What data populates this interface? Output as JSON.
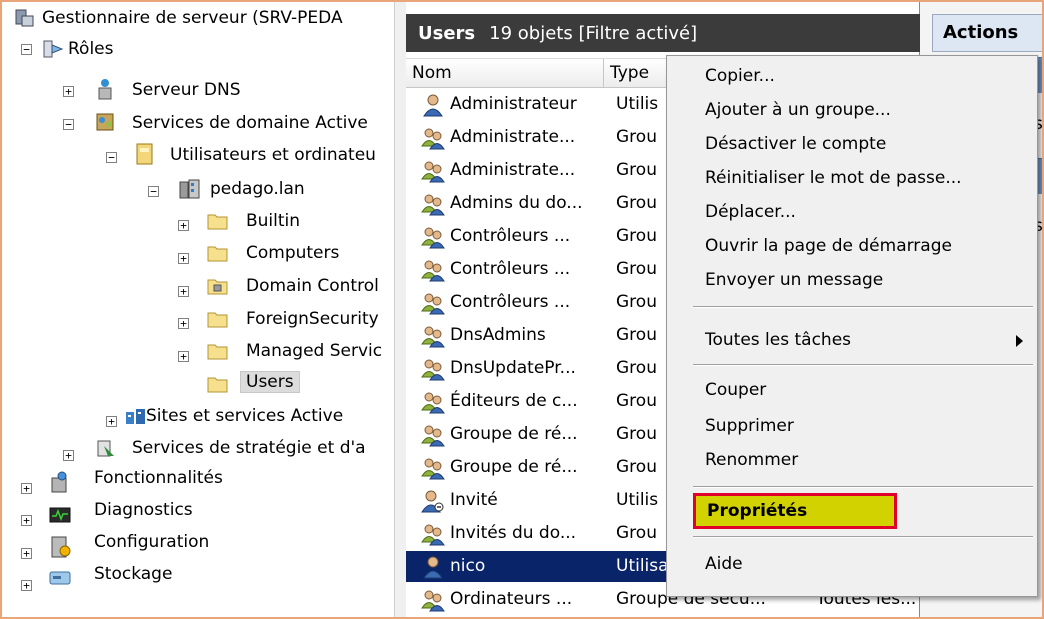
{
  "tree": {
    "root": "Gestionnaire de serveur (SRV-PEDA",
    "roles": "Rôles",
    "dns": "Serveur DNS",
    "adds": "Services de domaine Active",
    "aduc": "Utilisateurs et ordinateu",
    "domain": "pedago.lan",
    "builtin": "Builtin",
    "computers": "Computers",
    "dc": "Domain Control",
    "fsp": "ForeignSecurity",
    "msa": "Managed Servic",
    "users": "Users",
    "sites": "Sites et services Active",
    "gpm": "Services de stratégie et d'a",
    "features": "Fonctionnalités",
    "diagnostics": "Diagnostics",
    "configuration": "Configuration",
    "storage": "Stockage"
  },
  "middle": {
    "title": "Users",
    "subtitle": "19 objets  [Filtre activé]",
    "col_name": "Nom",
    "col_type": "Type",
    "rows": [
      {
        "name": "Administrateur",
        "type": "Utilis",
        "icon": "user-icon"
      },
      {
        "name": "Administrate...",
        "type": "Grou",
        "icon": "group-icon"
      },
      {
        "name": "Administrate...",
        "type": "Grou",
        "icon": "group-icon"
      },
      {
        "name": "Admins du do...",
        "type": "Grou",
        "icon": "group-icon"
      },
      {
        "name": "Contrôleurs ...",
        "type": "Grou",
        "icon": "group-icon"
      },
      {
        "name": "Contrôleurs ...",
        "type": "Grou",
        "icon": "group-icon"
      },
      {
        "name": "Contrôleurs ...",
        "type": "Grou",
        "icon": "group-icon"
      },
      {
        "name": "DnsAdmins",
        "type": "Grou",
        "icon": "group-icon"
      },
      {
        "name": "DnsUpdatePr...",
        "type": "Grou",
        "icon": "group-icon"
      },
      {
        "name": "Éditeurs de c...",
        "type": "Grou",
        "icon": "group-icon"
      },
      {
        "name": "Groupe de ré...",
        "type": "Grou",
        "icon": "group-icon"
      },
      {
        "name": "Groupe de ré...",
        "type": "Grou",
        "icon": "group-icon"
      },
      {
        "name": "Invité",
        "type": "Utilis",
        "icon": "disabled-user-icon"
      },
      {
        "name": "Invités du do...",
        "type": "Grou",
        "icon": "group-icon"
      },
      {
        "name": "nico",
        "type": "Utilisateur",
        "icon": "user-icon"
      },
      {
        "name": "Ordinateurs ...",
        "type": "Groupe de sécu...",
        "extra": "Toutes les...",
        "icon": "group-icon"
      }
    ]
  },
  "actions": {
    "title": "Actions",
    "peek1": "s",
    "peek2": "s"
  },
  "menu": {
    "copy": "Copier...",
    "add_group": "Ajouter à un groupe...",
    "disable": "Désactiver le compte",
    "reset_pw": "Réinitialiser le mot de passe...",
    "move": "Déplacer...",
    "home_page": "Ouvrir la page de démarrage",
    "send_mail": "Envoyer un message",
    "all_tasks": "Toutes les tâches",
    "cut": "Couper",
    "delete": "Supprimer",
    "rename": "Renommer",
    "properties": "Propriétés",
    "help": "Aide"
  },
  "colors": {
    "selection": "#0a246a",
    "highlight_fill": "#d2d200",
    "highlight_border": "#e0002a",
    "header_dark": "#3b3b3b"
  }
}
